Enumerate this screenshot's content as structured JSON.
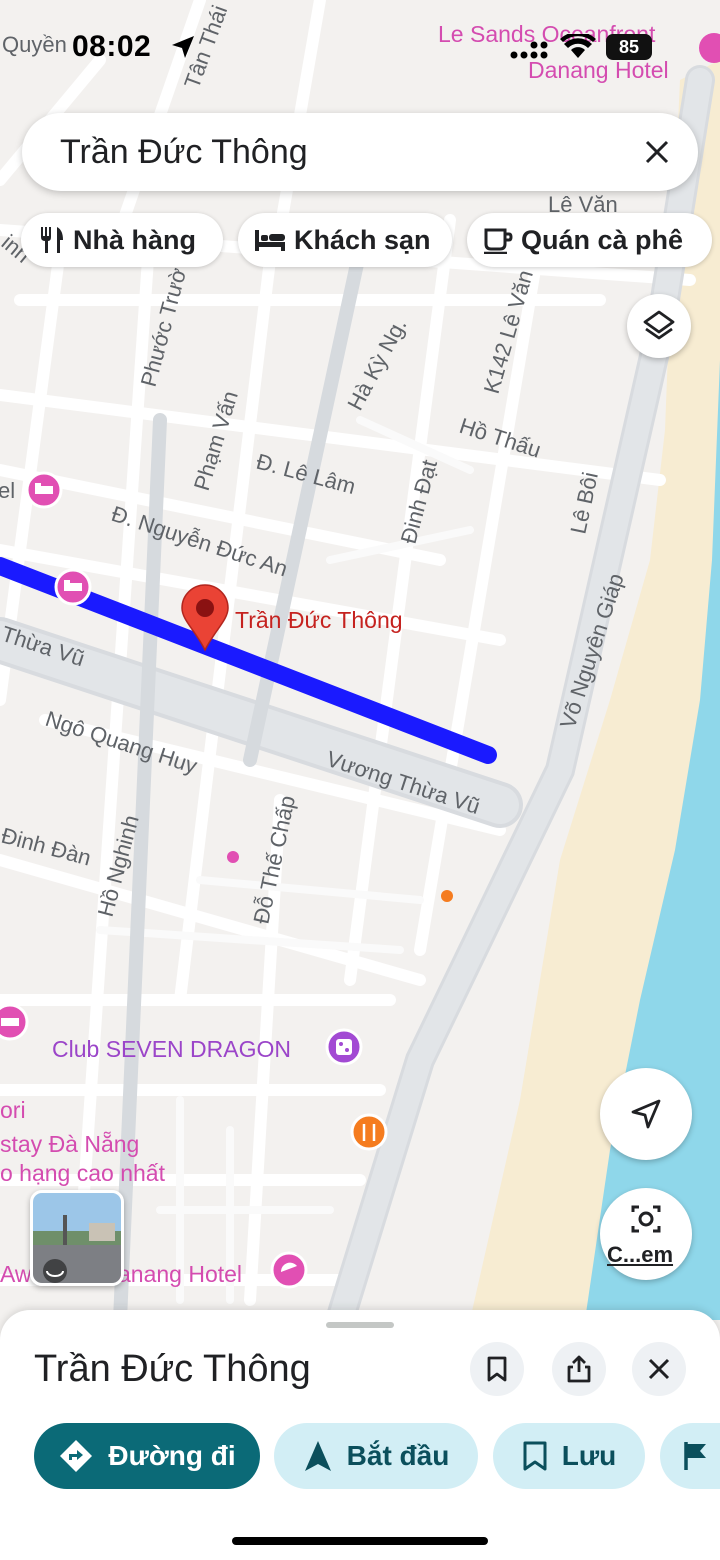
{
  "status_bar": {
    "time": "08:02",
    "battery": "85"
  },
  "search": {
    "query": "Trần Đức Thông"
  },
  "chips": [
    {
      "label": "Nhà hàng",
      "icon": "fork-knife-icon"
    },
    {
      "label": "Khách sạn",
      "icon": "bed-icon"
    },
    {
      "label": "Quán cà phê",
      "icon": "coffee-cup-icon"
    }
  ],
  "map": {
    "streets": {
      "quyen": "Quyền",
      "tan_thai": "Tân Thái",
      "phuoc_truong": "Phước Trườ",
      "pham_van": "Phạm Vấn",
      "ha_ky_ng": "Hà Kỳ Ng.",
      "k142_le_van": "K142 Lê Văn",
      "ho_thau": "Hồ Thấu",
      "le_boi": "Lê Bôi",
      "le_lam": "Đ. Lê Lâm",
      "dinh_dat": "Đinh Đạt",
      "nguyen_duc_an": "Đ. Nguyễn Đức An",
      "vo_nguyen_giap": "Võ Nguyên Giáp",
      "thua_vu_left": "Thừa Vũ",
      "ngo_quang_huy": "Ngô Quang Huy",
      "vuong_thua_vu": "Vương Thừa Vũ",
      "dinh_dan": "Đinh Đàn",
      "ho_nghinh": "Hồ Nghinh",
      "do_the_chap": "Đỗ Thế Chấp",
      "le_van_top": "Lê Văn",
      "el_fragment": "el",
      "inh_fragment": "inh"
    },
    "pois": {
      "le_sands_line1": "Le Sands Oceanfront",
      "le_sands_line2": "Danang Hotel",
      "selected_pin": "Trần Đức Thông",
      "club": "Club SEVEN DRAGON",
      "ori": "ori",
      "stay": "stay Đà Nẵng",
      "rating": "o hạng cao nhất",
      "aw_hotel_left": "Aw",
      "aw_hotel_right": "anang Hotel"
    },
    "colors": {
      "route": "#1a1aff",
      "water": "#8fd7ea",
      "sand": "#f7ecd2",
      "pin": "#ea4335",
      "hotel_poi": "#e14fb3",
      "nightlife_poi": "#a24ad3",
      "food_poi": "#f57c1f"
    }
  },
  "lens": {
    "label": "C...em"
  },
  "sheet": {
    "title": "Trần Đức Thông",
    "actions": [
      {
        "label": "Đường đi",
        "icon": "directions-icon"
      },
      {
        "label": "Bắt đầu",
        "icon": "navigation-arrow-icon"
      },
      {
        "label": "Lưu",
        "icon": "bookmark-icon"
      }
    ]
  }
}
